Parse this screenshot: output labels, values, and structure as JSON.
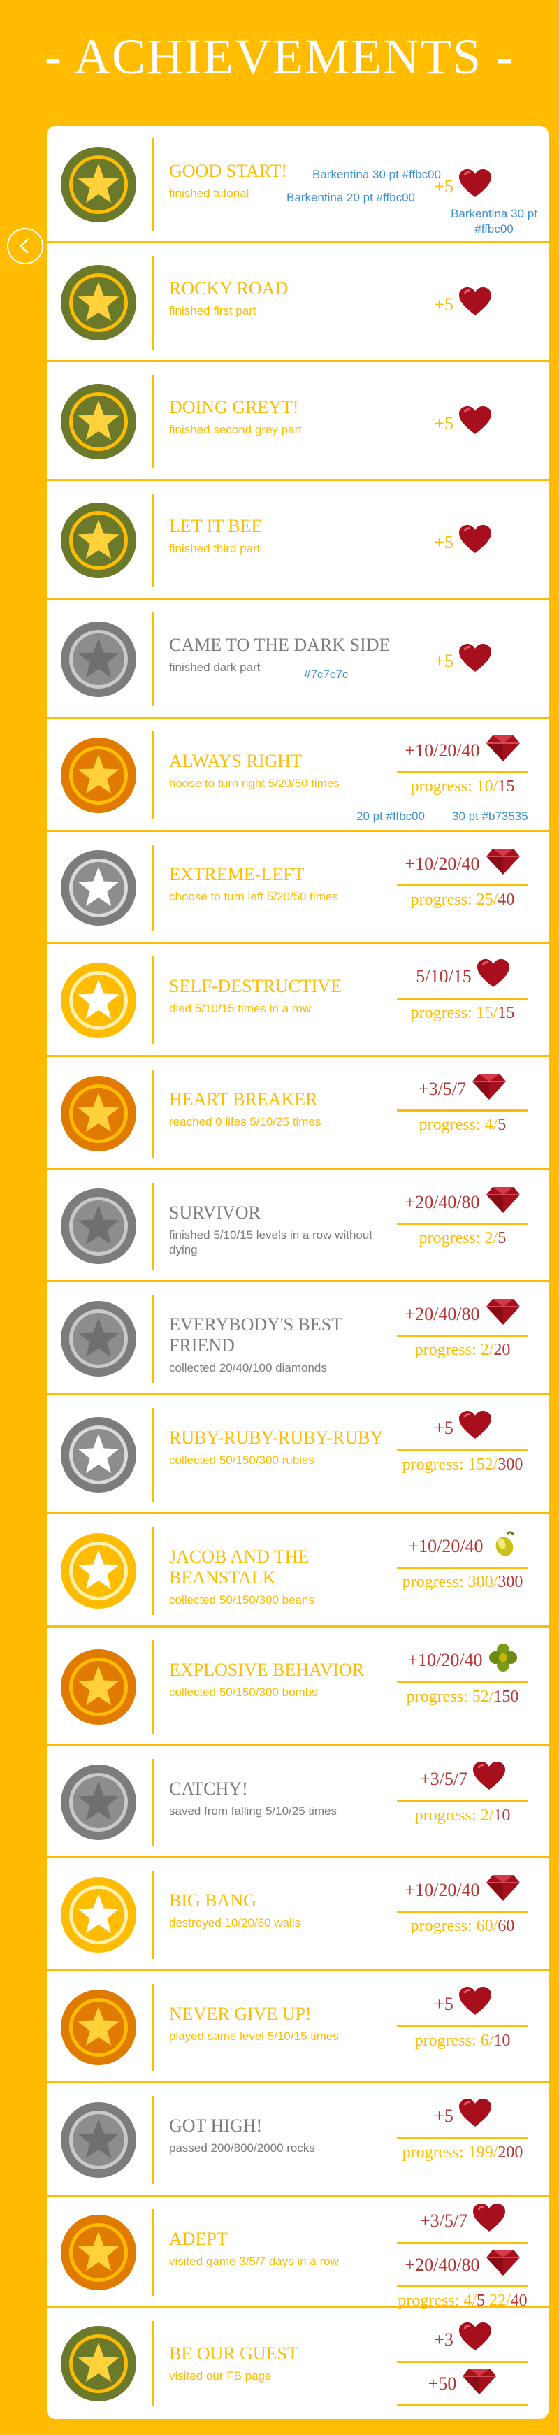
{
  "header": {
    "title": "- ACHIEVEMENTS -"
  },
  "nav": {
    "back_label": "<"
  },
  "annotations": {
    "title_font": "Barkentina 30 pt #ffbc00",
    "desc_font": "Barkentina 20 pt #ffbc00",
    "reward_font": "Barkentina 30 pt #ffbc00",
    "dark_color": "#7c7c7c",
    "progress_a": "20 pt #ffbc00",
    "progress_b": "30 pt #b73535"
  },
  "colors": {
    "accent": "#ffbc00",
    "grey": "#7c7c7c",
    "red": "#b73535",
    "green_medal": "#6b7a2a",
    "orange_medal": "#e07a00"
  },
  "achievements": [
    {
      "title": "GOOD START!",
      "desc": "finished  tutorial",
      "medal": "green",
      "dark": false,
      "rewards": [
        {
          "text": "+5",
          "icon": "heart-icon"
        }
      ]
    },
    {
      "title": "ROCKY ROAD",
      "desc": "finished first part",
      "medal": "green",
      "dark": false,
      "rewards": [
        {
          "text": "+5",
          "icon": "heart-icon"
        }
      ]
    },
    {
      "title": "DOING GREYT!",
      "desc": "finished second grey part",
      "medal": "green",
      "dark": false,
      "rewards": [
        {
          "text": "+5",
          "icon": "heart-icon"
        }
      ]
    },
    {
      "title": "LET IT BEE",
      "desc": "finished third part",
      "medal": "green",
      "dark": false,
      "rewards": [
        {
          "text": "+5",
          "icon": "heart-icon"
        }
      ]
    },
    {
      "title": "CAME TO THE DARK SIDE",
      "desc": "finished dark part",
      "medal": "grey",
      "dark": true,
      "rewards": [
        {
          "text": "+5",
          "icon": "heart-icon"
        }
      ]
    },
    {
      "title": "ALWAYS RIGHT",
      "desc": "hoose to turn right 5/20/50 times",
      "medal": "orange",
      "dark": false,
      "rewards": [
        {
          "text": "+10/20/40",
          "icon": "ruby-icon"
        }
      ],
      "progress": {
        "label": "progress: ",
        "cur": "10",
        "max": "15"
      }
    },
    {
      "title": "EXTREME-LEFT",
      "desc": "choose to turn left  5/20/50 times",
      "medal": "grey-white",
      "dark": false,
      "rewards": [
        {
          "text": "+10/20/40",
          "icon": "ruby-icon"
        }
      ],
      "progress": {
        "label": "progress: ",
        "cur": "25",
        "max": "40"
      }
    },
    {
      "title": "SELF-DESTRUCTIVE",
      "desc": "died 5/10/15 times in a row",
      "medal": "yellow",
      "dark": false,
      "rewards": [
        {
          "text": "5/10/15",
          "icon": "heart-icon"
        }
      ],
      "progress": {
        "label": "progress: ",
        "cur": "15",
        "max": "15"
      }
    },
    {
      "title": "HEART BREAKER",
      "desc": "reached 0 lifes 5/10/25 times",
      "medal": "orange",
      "dark": false,
      "rewards": [
        {
          "text": "+3/5/7",
          "icon": "ruby-icon"
        }
      ],
      "progress": {
        "label": "progress: ",
        "cur": "4",
        "max": "5"
      }
    },
    {
      "title": "SURVIVOR",
      "desc": "finished 5/10/15 levels in a row without dying",
      "medal": "grey",
      "dark": true,
      "rewards": [
        {
          "text": "+20/40/80",
          "icon": "ruby-icon"
        }
      ],
      "progress": {
        "label": "progress: ",
        "cur": "2",
        "max": "5"
      }
    },
    {
      "title": "EVERYBODY'S BEST FRIEND",
      "desc": " collected 20/40/100 diamonds",
      "medal": "grey",
      "dark": true,
      "rewards": [
        {
          "text": "+20/40/80",
          "icon": "ruby-icon"
        }
      ],
      "progress": {
        "label": "progress: ",
        "cur": "2",
        "max": "20"
      }
    },
    {
      "title": "RUBY-RUBY-RUBY-RUBY",
      "desc": "collected 50/150/300 rubies",
      "medal": "grey-white",
      "dark": false,
      "rewards": [
        {
          "text": "+5",
          "icon": "heart-icon"
        }
      ],
      "progress": {
        "label": "progress: ",
        "cur": "152",
        "max": "300"
      }
    },
    {
      "title": "JACOB AND THE BEANSTALK",
      "desc": "collected 50/150/300 beans",
      "medal": "yellow",
      "dark": false,
      "rewards": [
        {
          "text": "+10/20/40",
          "icon": "bean-icon"
        }
      ],
      "progress": {
        "label": "progress: ",
        "cur": "300",
        "max": "300"
      }
    },
    {
      "title": "EXPLOSIVE BEHAVIOR",
      "desc": "collected 50/150/300 bombs",
      "medal": "orange",
      "dark": false,
      "rewards": [
        {
          "text": "+10/20/40",
          "icon": "clover-icon"
        }
      ],
      "progress": {
        "label": "progress: ",
        "cur": "52",
        "max": "150"
      }
    },
    {
      "title": "CATCHY!",
      "desc": "saved from falling 5/10/25 times",
      "medal": "grey",
      "dark": true,
      "rewards": [
        {
          "text": "+3/5/7",
          "icon": "heart-icon"
        }
      ],
      "progress": {
        "label": "progress: ",
        "cur": "2",
        "max": "10"
      }
    },
    {
      "title": "BIG BANG",
      "desc": "destroyed 10/20/60 walls",
      "medal": "yellow",
      "dark": false,
      "rewards": [
        {
          "text": "+10/20/40",
          "icon": "ruby-icon"
        }
      ],
      "progress": {
        "label": "progress: ",
        "cur": "60",
        "max": "60"
      }
    },
    {
      "title": "NEVER GIVE UP!",
      "desc": "played same level 5/10/15 times",
      "medal": "orange",
      "dark": false,
      "rewards": [
        {
          "text": "+5",
          "icon": "heart-icon"
        }
      ],
      "progress": {
        "label": "progress: ",
        "cur": "6",
        "max": "10"
      }
    },
    {
      "title": "GOT HIGH!",
      "desc": "passed 200/800/2000 rocks",
      "medal": "grey",
      "dark": true,
      "rewards": [
        {
          "text": "+5",
          "icon": "heart-icon"
        }
      ],
      "progress": {
        "label": "progress: ",
        "cur": "199",
        "max": "200"
      }
    },
    {
      "title": "ADEPT",
      "desc": "visited game 3/5/7 days in a row",
      "medal": "orange",
      "dark": false,
      "rewards": [
        {
          "text": "+3/5/7",
          "icon": "heart-icon"
        },
        {
          "text": "+20/40/80",
          "icon": "ruby-icon"
        }
      ],
      "progress": {
        "label": "progress: ",
        "cur": "4",
        "max": "5",
        "cur2": "22",
        "max2": "40"
      }
    },
    {
      "title": "BE OUR GUEST",
      "desc": "visited our FB page",
      "medal": "green",
      "dark": false,
      "rewards": [
        {
          "text": "+3",
          "icon": "heart-icon"
        },
        {
          "text": "+50",
          "icon": "ruby-icon"
        }
      ]
    }
  ]
}
